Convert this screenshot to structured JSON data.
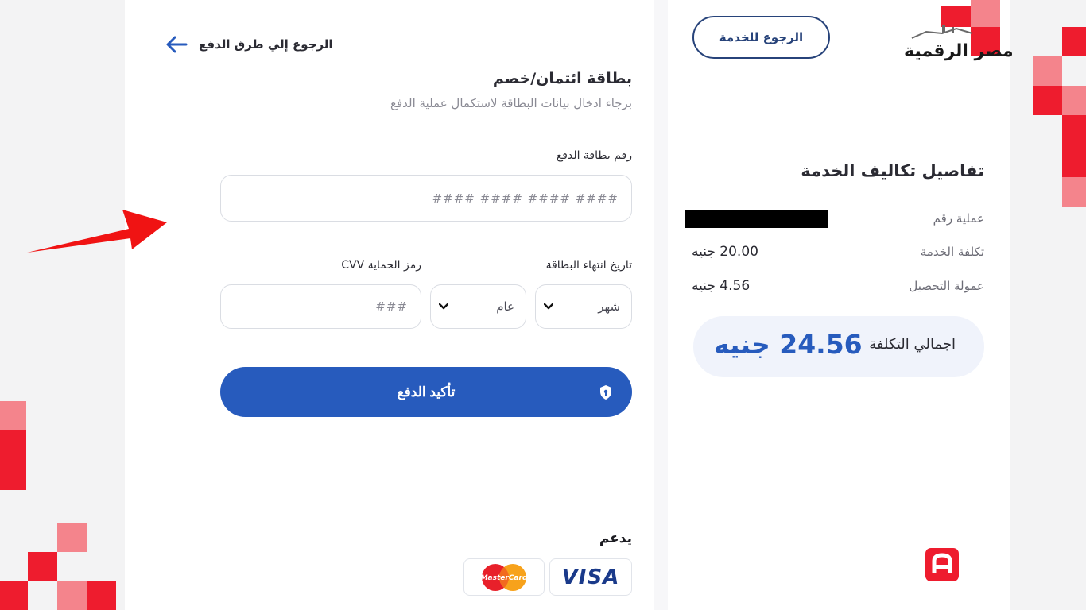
{
  "nav": {
    "back_to_methods": "الرجوع إلي طرق الدفع",
    "back_to_service": "الرجوع للخدمة"
  },
  "brand": {
    "logo_text": "مصر الرقمية"
  },
  "form": {
    "title": "بطاقة ائتمان/خصم",
    "subtitle": "برجاء ادخال بيانات البطاقة لاستكمال عملية الدفع",
    "card_number": {
      "label": "رقم بطاقة الدفع",
      "placeholder": "#### #### #### ####",
      "value": ""
    },
    "expiry": {
      "label": "تاريخ انتهاء البطاقة",
      "month_selected": "شهر",
      "year_selected": "عام"
    },
    "cvv": {
      "label": "رمز الحماية CVV",
      "placeholder": "###",
      "value": ""
    },
    "confirm_label": "تأكيد الدفع",
    "supports_label": "يدعم",
    "card_brands": [
      "VISA",
      "MasterCard"
    ]
  },
  "summary": {
    "title": "تفاصيل تكاليف الخدمة",
    "rows": [
      {
        "label": "عملية رقم",
        "value": ""
      },
      {
        "label": "تكلفة الخدمة",
        "value": "20.00 جنيه"
      },
      {
        "label": "عمولة التحصيل",
        "value": "4.56 جنيه"
      }
    ],
    "total_label": "اجمالي التكلفة",
    "total_value": "24.56 جنيه"
  },
  "colors": {
    "primary_blue": "#275bbd",
    "brand_red": "#ee1c2e",
    "navy": "#27437a"
  },
  "icons": {
    "back": "arrow-right-icon",
    "shield": "shield-check-icon",
    "chevron": "chevron-down-icon",
    "help": "help-app-icon",
    "annotation": "red-pointer-arrow"
  }
}
